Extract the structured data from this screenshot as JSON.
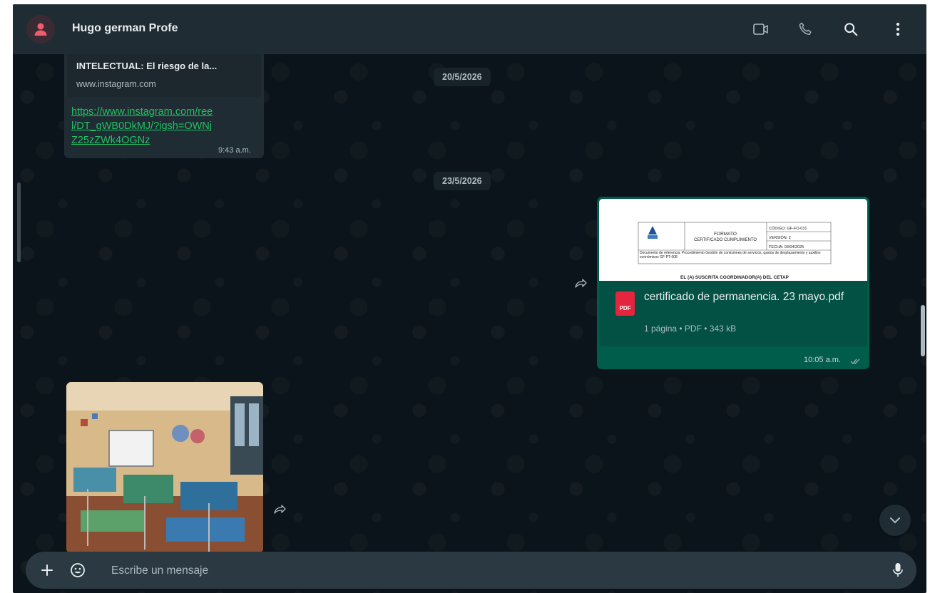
{
  "header": {
    "contact_name": "Hugo german Profe",
    "icons": [
      "video-call-icon",
      "voice-call-icon",
      "search-icon",
      "menu-icon"
    ]
  },
  "chat": {
    "date_separators": [
      "20/5/2026",
      "23/5/2026"
    ],
    "link_message": {
      "preview_title": "INTELECTUAL: El riesgo de la...",
      "preview_domain": "www.instagram.com",
      "url_text": "https://www.instagram.com/reel/DT_gWB0DkMJ/?igsh=OWNjZ25zZWk4OGNz",
      "time": "9:43 a.m."
    },
    "document_message": {
      "preview": {
        "format_title": "FORMATO",
        "format_subtitle": "CERTIFICADO CUMPLIMIENTO",
        "code": "CÓDIGO: GF-FO-031",
        "version": "VERSIÓN: 2",
        "date": "FECHA: 03/04/2025",
        "reference": "Documento de referencia: Procedimiento Gestión de comisiones de servicios, gastos de desplazamiento y auxilios económicos GF-PT-008",
        "body_heading": "EL (A) SUSCRITA COORDINADOR(A) DEL CETAP"
      },
      "file_name": "certificado de permanencia. 23 mayo.pdf",
      "meta": "1 página • PDF • 343 kB",
      "badge": "PDF",
      "time": "10:05 a.m."
    },
    "image_message": {
      "description": "photo"
    }
  },
  "composer": {
    "placeholder": "Escribe un mensaje"
  },
  "colors": {
    "background": "#0b141a",
    "header": "#202c33",
    "incoming": "#202c33",
    "outgoing": "#005c4b",
    "link": "#21c063",
    "pdf_red": "#e3263d"
  }
}
